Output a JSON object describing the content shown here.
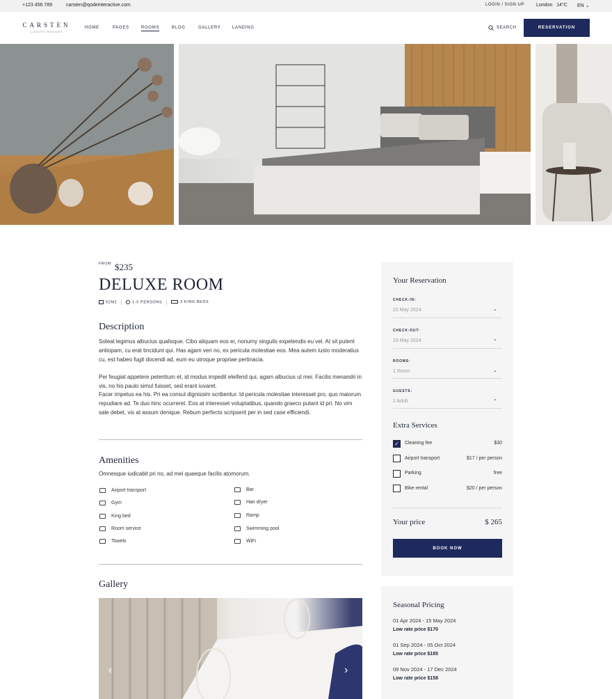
{
  "topbar": {
    "phone": "+123 456 789",
    "email": "carsten@qodeinteractive.com",
    "login": "LOGIN / SIGN UP",
    "city": "London",
    "temp": "14°C",
    "lang": "EN"
  },
  "header": {
    "logo_name": "CARSTEN",
    "logo_sub": "LUXURY RESORT",
    "nav": [
      "HOME",
      "PAGES",
      "ROOMS",
      "BLOG",
      "GALLERY",
      "LANDING"
    ],
    "search_label": "SEARCH",
    "reservation_label": "RESERVATION"
  },
  "room": {
    "from_label": "FROM",
    "price": "$235",
    "title": "DELUXE ROOM",
    "size": "52M2",
    "persons": "1-5 PERSONS",
    "beds": "3 KING BEDS"
  },
  "description": {
    "title": "Description",
    "p1": "Soleat legimus albucius qualisque. Cibo aliquam eos ei, nonumy singulis expetendis eu vel. At sit putent antiopam, cu erat tincidunt qui. Has agam veri no, ex pericula molestiae eos. Mea autem iusto moderatius cu, est habeo fugit docendi ad, eum eu utroque propriae pertinacia.",
    "p2": "Per feugiat appetere petentium et, id modus impedit eleifend qui, agam albucius ut mei. Facilis menandri in vis, no his paulo simul fuisset, sed erant iuvaret.",
    "p3": "Facer impetus ea his. Pri ea consul dignissim scribentur. Id pericula molestiae interesset pro, quo maiorum repudiare ad. Te duo hinc ocurreret. Eos at interesset voluptatibus, quando graeco putant id pri. No vim sale debet, vis at assum denique. Rebum perfecto scripserit per in sed case efficiendi."
  },
  "amenities": {
    "title": "Amenities",
    "intro": "Omnesque iudicabit pri no, ad mel quaeque facilis atomorum.",
    "left": [
      "Airport transport",
      "Gym",
      "King bed",
      "Room service",
      "Towels"
    ],
    "right": [
      "Bar",
      "Hair dryer",
      "Ramp",
      "Swimming pool",
      "WiFi"
    ]
  },
  "gallery": {
    "title": "Gallery"
  },
  "reservation": {
    "title": "Your Reservation",
    "checkin_label": "CHECK-IN:",
    "checkin_value": "22 May 2024",
    "checkout_label": "CHECK-OUT:",
    "checkout_value": "23 May 2024",
    "rooms_label": "ROOMS:",
    "rooms_value": "1 Room",
    "guests_label": "GUESTS:",
    "guests_value": "1 Adult",
    "extra_title": "Extra Services",
    "services": [
      {
        "name": "Cleaning fee",
        "price": "$30",
        "checked": true
      },
      {
        "name": "Airport transport",
        "price": "$17 / per person",
        "checked": false
      },
      {
        "name": "Parking",
        "price": "free",
        "checked": false
      },
      {
        "name": "Bike rental",
        "price": "$20 / per person",
        "checked": false
      }
    ],
    "your_price_label": "Your price",
    "your_price_value": "$ 265",
    "book_label": "BOOK NOW"
  },
  "seasonal": {
    "title": "Seasonal Pricing",
    "items": [
      {
        "dates": "01 Apr 2024 - 15 May 2024",
        "rate": "Low rate price $170"
      },
      {
        "dates": "01 Sep 2024 - 05 Oct 2024",
        "rate": "Low rate price $185"
      },
      {
        "dates": "09 Nov 2024 - 17 Dec 2024",
        "rate": "Low rate price $158"
      }
    ]
  },
  "colors": {
    "accent": "#1e2a5e",
    "panel": "#f5f5f5",
    "text": "#1d2437"
  }
}
